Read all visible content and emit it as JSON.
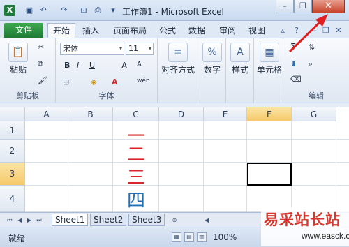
{
  "window": {
    "title": "工作簿1 - Microsoft Excel",
    "minimize_icon": "minimize-icon",
    "restore_icon": "restore-icon",
    "close_icon": "close-icon"
  },
  "quick_access": [
    "save-icon",
    "undo-icon",
    "redo-icon",
    "print-preview-icon",
    "print-icon",
    "customize-icon"
  ],
  "tabs": {
    "file": "文件",
    "items": [
      "开始",
      "插入",
      "页面布局",
      "公式",
      "数据",
      "审阅",
      "视图"
    ],
    "active": "开始"
  },
  "ribbon": {
    "clipboard": {
      "label": "剪贴板",
      "paste": "粘贴"
    },
    "font": {
      "label": "字体",
      "name": "宋体",
      "size": "11",
      "bold": "B",
      "italic": "I",
      "underline": "U",
      "grow": "A",
      "shrink": "A",
      "color_a": "A",
      "phonetic": "wén"
    },
    "alignment": {
      "label": "对齐方式"
    },
    "number": {
      "label": "数字"
    },
    "styles": {
      "label": "样式"
    },
    "cells": {
      "label": "单元格"
    },
    "editing": {
      "label": "编辑"
    }
  },
  "grid": {
    "columns": [
      "A",
      "B",
      "C",
      "D",
      "E",
      "F",
      "G"
    ],
    "rows": [
      "1",
      "2",
      "3",
      "4"
    ],
    "cells": [
      {
        "text": "一",
        "color": "#d9252b"
      },
      {
        "text": "二",
        "color": "#d9252b"
      },
      {
        "text": "三",
        "color": "#d9252b"
      },
      {
        "text": "四",
        "color": "#2270b5"
      }
    ],
    "selected_column": "F",
    "selected_row": "3"
  },
  "sheets": [
    "Sheet1",
    "Sheet2",
    "Sheet3"
  ],
  "status": {
    "ready": "就绪",
    "zoom": "100%"
  },
  "watermark": {
    "text": "易采站长站",
    "url": "www.easck.com"
  },
  "colors": {
    "accent_green": "#1e7b35",
    "close_red": "#c7432a",
    "arrow_red": "#e02020"
  }
}
